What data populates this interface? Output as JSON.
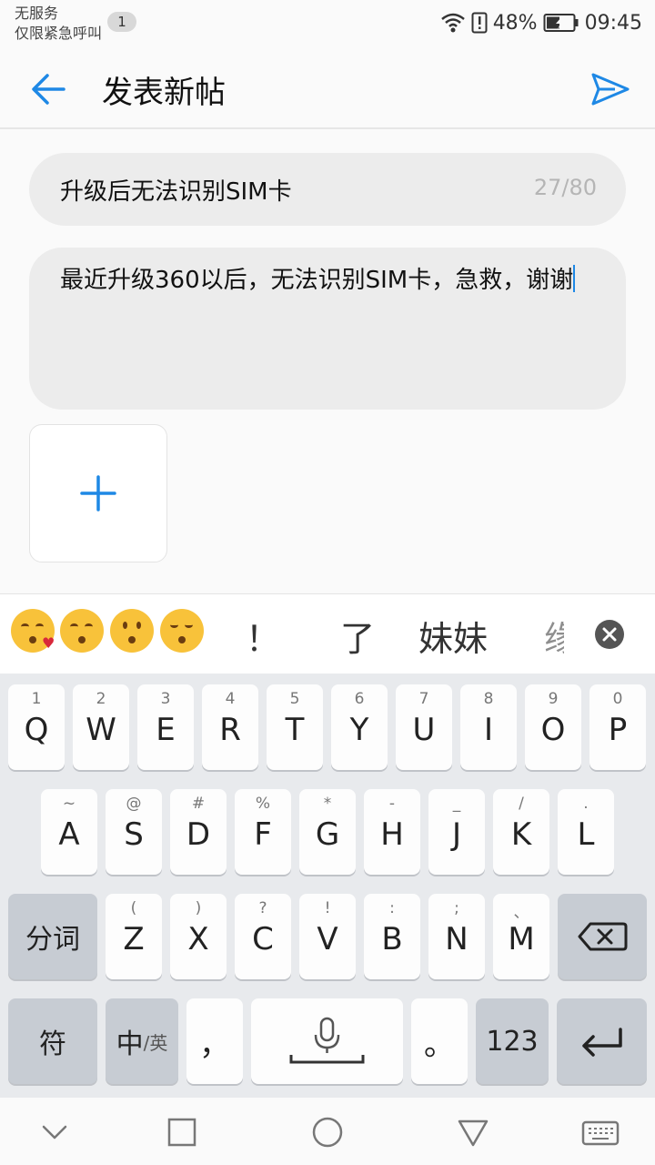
{
  "status": {
    "carrier_line1": "无服务",
    "carrier_line2": "仅限紧急呼叫",
    "badge": "1",
    "battery": "48%",
    "time": "09:45"
  },
  "header": {
    "title": "发表新帖"
  },
  "form": {
    "title_value": "升级后无法识别SIM卡",
    "title_count": "27/80",
    "body_value": "最近升级360以后，无法识别SIM卡，急救，谢谢"
  },
  "candidates": {
    "emojis": [
      "kissing-heart-emoji",
      "kissing-closed-eyes-emoji",
      "kissing-emoji",
      "kissing-smiling-eyes-emoji"
    ],
    "words": [
      "！",
      "了",
      "妹妹",
      "缘"
    ]
  },
  "keyboard": {
    "row1": [
      {
        "main": "Q",
        "sub": "1"
      },
      {
        "main": "W",
        "sub": "2"
      },
      {
        "main": "E",
        "sub": "3"
      },
      {
        "main": "R",
        "sub": "4"
      },
      {
        "main": "T",
        "sub": "5"
      },
      {
        "main": "Y",
        "sub": "6"
      },
      {
        "main": "U",
        "sub": "7"
      },
      {
        "main": "I",
        "sub": "8"
      },
      {
        "main": "O",
        "sub": "9"
      },
      {
        "main": "P",
        "sub": "0"
      }
    ],
    "row2": [
      {
        "main": "A",
        "sub": "~"
      },
      {
        "main": "S",
        "sub": "@"
      },
      {
        "main": "D",
        "sub": "#"
      },
      {
        "main": "F",
        "sub": "%"
      },
      {
        "main": "G",
        "sub": "*"
      },
      {
        "main": "H",
        "sub": "-"
      },
      {
        "main": "J",
        "sub": "_"
      },
      {
        "main": "K",
        "sub": "/"
      },
      {
        "main": "L",
        "sub": "."
      }
    ],
    "row3": [
      {
        "main": "Z",
        "sub": "("
      },
      {
        "main": "X",
        "sub": ")"
      },
      {
        "main": "C",
        "sub": "?"
      },
      {
        "main": "V",
        "sub": "!"
      },
      {
        "main": "B",
        "sub": ":"
      },
      {
        "main": "N",
        "sub": ";"
      },
      {
        "main": "M",
        "sub": "、"
      }
    ],
    "segment_label": "分词",
    "symbol_label": "符",
    "lang_main": "中",
    "lang_sub": "/英",
    "comma_label": "，",
    "period_label": "。",
    "num_label": "123"
  }
}
